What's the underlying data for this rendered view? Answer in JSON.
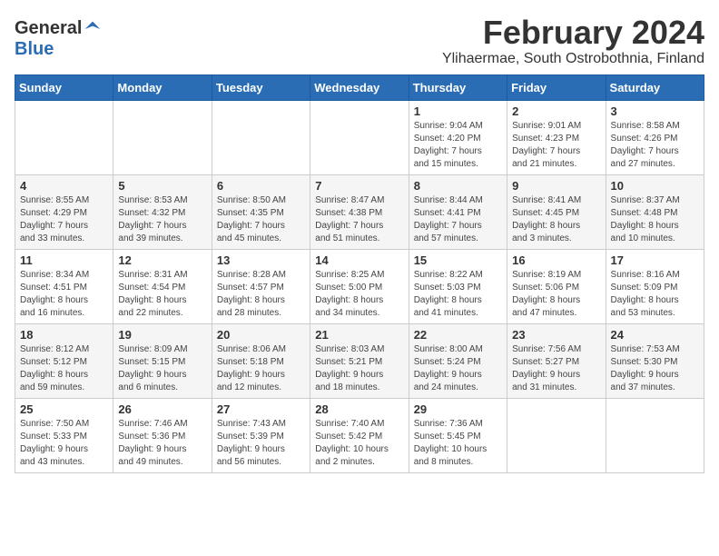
{
  "logo": {
    "general": "General",
    "blue": "Blue"
  },
  "title": "February 2024",
  "subtitle": "Ylihaermae, South Ostrobothnia, Finland",
  "days_of_week": [
    "Sunday",
    "Monday",
    "Tuesday",
    "Wednesday",
    "Thursday",
    "Friday",
    "Saturday"
  ],
  "weeks": [
    [
      {
        "day": "",
        "info": ""
      },
      {
        "day": "",
        "info": ""
      },
      {
        "day": "",
        "info": ""
      },
      {
        "day": "",
        "info": ""
      },
      {
        "day": "1",
        "info": "Sunrise: 9:04 AM\nSunset: 4:20 PM\nDaylight: 7 hours\nand 15 minutes."
      },
      {
        "day": "2",
        "info": "Sunrise: 9:01 AM\nSunset: 4:23 PM\nDaylight: 7 hours\nand 21 minutes."
      },
      {
        "day": "3",
        "info": "Sunrise: 8:58 AM\nSunset: 4:26 PM\nDaylight: 7 hours\nand 27 minutes."
      }
    ],
    [
      {
        "day": "4",
        "info": "Sunrise: 8:55 AM\nSunset: 4:29 PM\nDaylight: 7 hours\nand 33 minutes."
      },
      {
        "day": "5",
        "info": "Sunrise: 8:53 AM\nSunset: 4:32 PM\nDaylight: 7 hours\nand 39 minutes."
      },
      {
        "day": "6",
        "info": "Sunrise: 8:50 AM\nSunset: 4:35 PM\nDaylight: 7 hours\nand 45 minutes."
      },
      {
        "day": "7",
        "info": "Sunrise: 8:47 AM\nSunset: 4:38 PM\nDaylight: 7 hours\nand 51 minutes."
      },
      {
        "day": "8",
        "info": "Sunrise: 8:44 AM\nSunset: 4:41 PM\nDaylight: 7 hours\nand 57 minutes."
      },
      {
        "day": "9",
        "info": "Sunrise: 8:41 AM\nSunset: 4:45 PM\nDaylight: 8 hours\nand 3 minutes."
      },
      {
        "day": "10",
        "info": "Sunrise: 8:37 AM\nSunset: 4:48 PM\nDaylight: 8 hours\nand 10 minutes."
      }
    ],
    [
      {
        "day": "11",
        "info": "Sunrise: 8:34 AM\nSunset: 4:51 PM\nDaylight: 8 hours\nand 16 minutes."
      },
      {
        "day": "12",
        "info": "Sunrise: 8:31 AM\nSunset: 4:54 PM\nDaylight: 8 hours\nand 22 minutes."
      },
      {
        "day": "13",
        "info": "Sunrise: 8:28 AM\nSunset: 4:57 PM\nDaylight: 8 hours\nand 28 minutes."
      },
      {
        "day": "14",
        "info": "Sunrise: 8:25 AM\nSunset: 5:00 PM\nDaylight: 8 hours\nand 34 minutes."
      },
      {
        "day": "15",
        "info": "Sunrise: 8:22 AM\nSunset: 5:03 PM\nDaylight: 8 hours\nand 41 minutes."
      },
      {
        "day": "16",
        "info": "Sunrise: 8:19 AM\nSunset: 5:06 PM\nDaylight: 8 hours\nand 47 minutes."
      },
      {
        "day": "17",
        "info": "Sunrise: 8:16 AM\nSunset: 5:09 PM\nDaylight: 8 hours\nand 53 minutes."
      }
    ],
    [
      {
        "day": "18",
        "info": "Sunrise: 8:12 AM\nSunset: 5:12 PM\nDaylight: 8 hours\nand 59 minutes."
      },
      {
        "day": "19",
        "info": "Sunrise: 8:09 AM\nSunset: 5:15 PM\nDaylight: 9 hours\nand 6 minutes."
      },
      {
        "day": "20",
        "info": "Sunrise: 8:06 AM\nSunset: 5:18 PM\nDaylight: 9 hours\nand 12 minutes."
      },
      {
        "day": "21",
        "info": "Sunrise: 8:03 AM\nSunset: 5:21 PM\nDaylight: 9 hours\nand 18 minutes."
      },
      {
        "day": "22",
        "info": "Sunrise: 8:00 AM\nSunset: 5:24 PM\nDaylight: 9 hours\nand 24 minutes."
      },
      {
        "day": "23",
        "info": "Sunrise: 7:56 AM\nSunset: 5:27 PM\nDaylight: 9 hours\nand 31 minutes."
      },
      {
        "day": "24",
        "info": "Sunrise: 7:53 AM\nSunset: 5:30 PM\nDaylight: 9 hours\nand 37 minutes."
      }
    ],
    [
      {
        "day": "25",
        "info": "Sunrise: 7:50 AM\nSunset: 5:33 PM\nDaylight: 9 hours\nand 43 minutes."
      },
      {
        "day": "26",
        "info": "Sunrise: 7:46 AM\nSunset: 5:36 PM\nDaylight: 9 hours\nand 49 minutes."
      },
      {
        "day": "27",
        "info": "Sunrise: 7:43 AM\nSunset: 5:39 PM\nDaylight: 9 hours\nand 56 minutes."
      },
      {
        "day": "28",
        "info": "Sunrise: 7:40 AM\nSunset: 5:42 PM\nDaylight: 10 hours\nand 2 minutes."
      },
      {
        "day": "29",
        "info": "Sunrise: 7:36 AM\nSunset: 5:45 PM\nDaylight: 10 hours\nand 8 minutes."
      },
      {
        "day": "",
        "info": ""
      },
      {
        "day": "",
        "info": ""
      }
    ]
  ]
}
